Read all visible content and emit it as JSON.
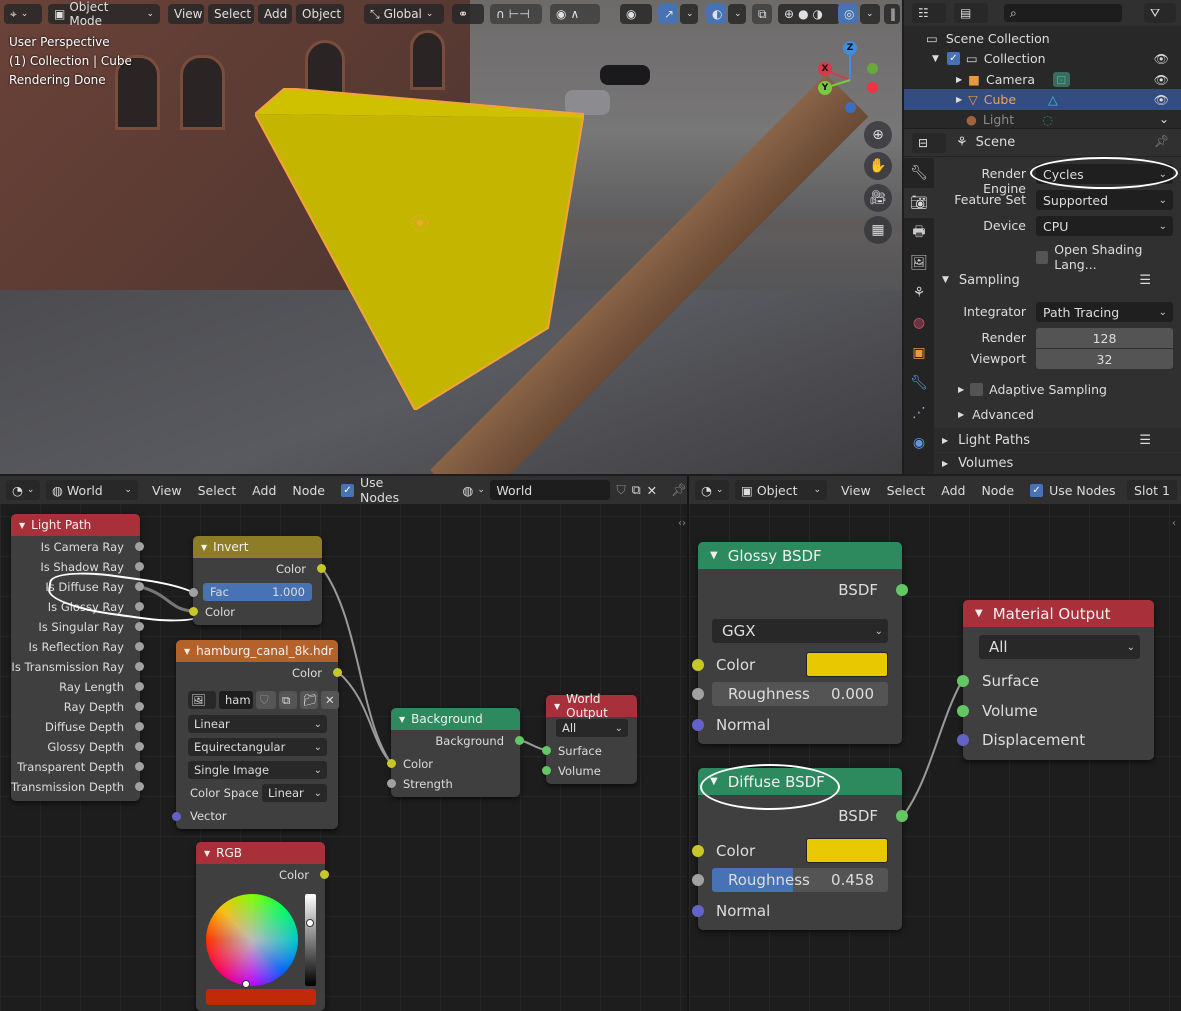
{
  "viewport": {
    "header": {
      "editor_icon": "viewport-icon",
      "mode": "Object Mode",
      "menus": [
        "View",
        "Select",
        "Add",
        "Object"
      ],
      "orientation": "Global"
    },
    "overlay": {
      "perspective": "User Perspective",
      "collection": "(1) Collection | Cube",
      "status": "Rendering Done"
    },
    "gizmo": {
      "x": "X",
      "y": "Y",
      "z": "Z"
    },
    "nav_buttons": [
      "zoom-icon",
      "hand-icon",
      "camera-icon",
      "grid-icon"
    ],
    "cube_color": "#c8b400",
    "outline_color": "#f5a23a"
  },
  "outliner": {
    "search_placeholder": "",
    "items": [
      {
        "label": "Scene Collection"
      },
      {
        "label": "Collection"
      },
      {
        "label": "Camera"
      },
      {
        "label": "Cube"
      },
      {
        "label": "Light"
      }
    ]
  },
  "properties": {
    "context": "Scene",
    "render_engine_label": "Render Engine",
    "render_engine": "Cycles",
    "feature_set_label": "Feature Set",
    "feature_set": "Supported",
    "device_label": "Device",
    "device": "CPU",
    "osl_label": "Open Shading Lang...",
    "sampling": {
      "title": "Sampling",
      "integrator_label": "Integrator",
      "integrator": "Path Tracing",
      "render_label": "Render",
      "render": "128",
      "viewport_label": "Viewport",
      "viewport": "32",
      "adaptive": "Adaptive Sampling",
      "advanced": "Advanced"
    },
    "light_paths": "Light Paths",
    "volumes": "Volumes"
  },
  "world_editor": {
    "header": {
      "type": "World",
      "menus": [
        "View",
        "Select",
        "Add",
        "Node"
      ],
      "use_nodes": "Use Nodes",
      "datablock": "World"
    },
    "light_path": {
      "title": "Light Path",
      "outputs": [
        "Is Camera Ray",
        "Is Shadow Ray",
        "Is Diffuse Ray",
        "Is Glossy Ray",
        "Is Singular Ray",
        "Is Reflection Ray",
        "Is Transmission Ray",
        "Ray Length",
        "Ray Depth",
        "Diffuse Depth",
        "Glossy Depth",
        "Transparent Depth",
        "Transmission Depth"
      ]
    },
    "invert": {
      "title": "Invert",
      "out": "Color",
      "fac_label": "Fac",
      "fac": "1.000",
      "in_color": "Color"
    },
    "image": {
      "title": "hamburg_canal_8k.hdr",
      "out": "Color",
      "image_name": "ham",
      "interpolation": "Linear",
      "projection": "Equirectangular",
      "source": "Single Image",
      "color_space_label": "Color Space",
      "color_space": "Linear",
      "vector": "Vector"
    },
    "rgb": {
      "title": "RGB",
      "out": "Color",
      "swatch": "#c02a08"
    },
    "background": {
      "title": "Background",
      "out": "Background",
      "color": "Color",
      "strength": "Strength"
    },
    "world_output": {
      "title": "World Output",
      "target": "All",
      "surface": "Surface",
      "volume": "Volume"
    }
  },
  "material_editor": {
    "header": {
      "type": "Object",
      "menus": [
        "View",
        "Select",
        "Add",
        "Node"
      ],
      "use_nodes": "Use Nodes",
      "slot": "Slot 1"
    },
    "glossy": {
      "title": "Glossy BSDF",
      "out": "BSDF",
      "distribution": "GGX",
      "color": "Color",
      "color_value": "#e8c800",
      "roughness_label": "Roughness",
      "roughness": "0.000",
      "normal": "Normal"
    },
    "diffuse": {
      "title": "Diffuse BSDF",
      "out": "BSDF",
      "color": "Color",
      "color_value": "#e8c800",
      "roughness_label": "Roughness",
      "roughness": "0.458",
      "roughness_fraction": 0.458,
      "normal": "Normal"
    },
    "output": {
      "title": "Material Output",
      "target": "All",
      "surface": "Surface",
      "volume": "Volume",
      "displacement": "Displacement"
    }
  }
}
